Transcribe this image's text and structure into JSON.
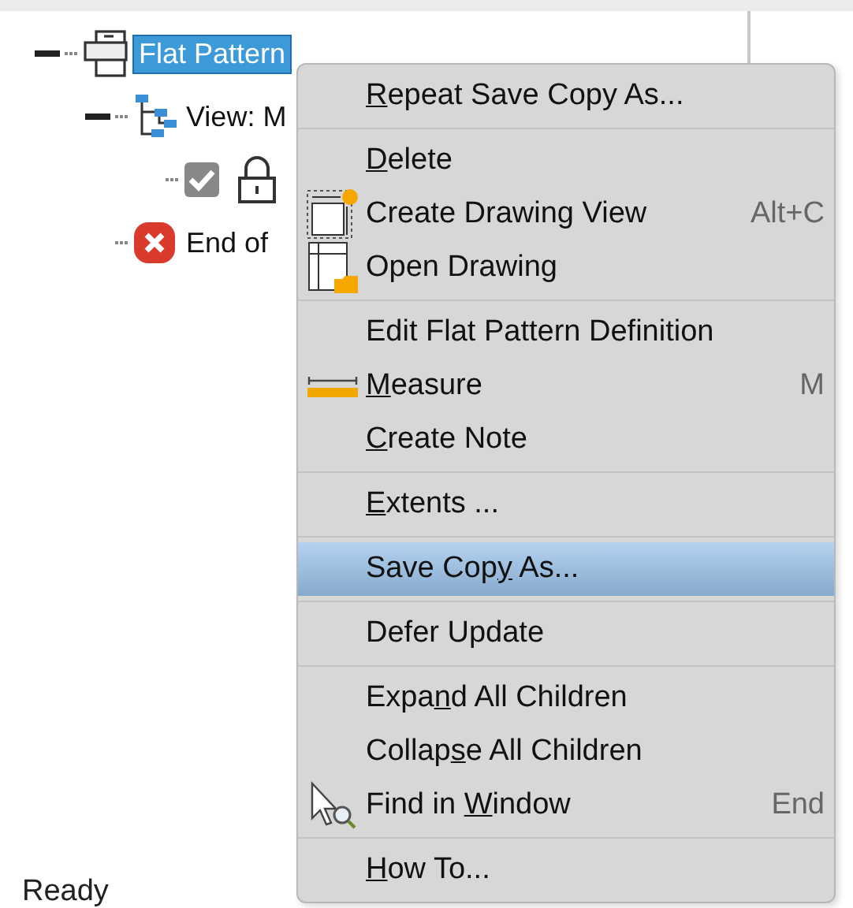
{
  "tree": {
    "items": [
      {
        "label": "Flat Pattern",
        "kind": "flat-pattern",
        "selected": true,
        "expanded": true,
        "children": [
          {
            "label": "View: M",
            "kind": "view",
            "selected": false,
            "expanded": true,
            "children": [
              {
                "kind": "check-lock"
              }
            ]
          },
          {
            "label": "End of",
            "kind": "end",
            "selected": false
          }
        ]
      }
    ]
  },
  "menu": {
    "groups": [
      {
        "items": [
          {
            "key": "R",
            "after": "epeat Save Copy As...",
            "selected": false
          }
        ]
      },
      {
        "items": [
          {
            "key": "D",
            "after": "elete",
            "selected": false
          },
          {
            "text": "Create Drawing View",
            "shortcut": "Alt+C",
            "kind": "drawing-view",
            "selected": false
          },
          {
            "text": "Open Drawing",
            "kind": "open-drawing",
            "selected": false
          }
        ]
      },
      {
        "items": [
          {
            "text": "Edit Flat Pattern Definition",
            "selected": false
          },
          {
            "key": "M",
            "after": "easure",
            "shortcut": "M",
            "kind": "measure",
            "selected": false
          },
          {
            "key": "C",
            "after": "reate Note",
            "selected": false
          }
        ]
      },
      {
        "items": [
          {
            "key": "E",
            "after": "xtents ...",
            "selected": false
          }
        ]
      },
      {
        "items": [
          {
            "before": "Save Cop",
            "key": "y",
            "after": " As...",
            "selected": true
          }
        ]
      },
      {
        "items": [
          {
            "text": "Defer Update",
            "selected": false
          }
        ]
      },
      {
        "items": [
          {
            "before": "Expa",
            "key": "n",
            "after": "d All Children",
            "selected": false
          },
          {
            "before": "Collap",
            "key": "s",
            "after": "e All Children",
            "selected": false
          },
          {
            "before": "Find in ",
            "key": "W",
            "after": "indow",
            "shortcut": "End",
            "kind": "find",
            "selected": false
          }
        ]
      },
      {
        "items": [
          {
            "key": "H",
            "after": "ow To...",
            "selected": false
          }
        ]
      }
    ]
  },
  "status_bar": {
    "text": "Ready"
  }
}
